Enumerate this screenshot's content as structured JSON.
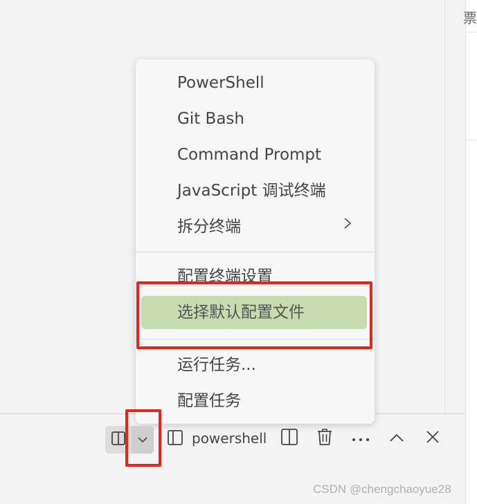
{
  "editor": {
    "right_edge_text": "票"
  },
  "menu": {
    "items": [
      {
        "label": "PowerShell"
      },
      {
        "label": "Git Bash"
      },
      {
        "label": "Command Prompt"
      },
      {
        "label": "JavaScript 调试终端"
      },
      {
        "label": "拆分终端",
        "submenu_icon": "chevron-right-icon"
      },
      {
        "label": "配置终端设置"
      },
      {
        "label": "选择默认配置文件",
        "highlighted": true
      },
      {
        "label": "运行任务..."
      },
      {
        "label": "配置任务"
      }
    ]
  },
  "toolbar": {
    "terminal_name": "powershell",
    "icons": [
      "split-layout-icon",
      "chevron-down-icon",
      "split-terminal-icon",
      "split-view-icon",
      "trash-icon",
      "more-icon",
      "chevron-up-icon",
      "close-icon"
    ]
  },
  "watermark": "CSDN @chengchaoyue28",
  "colors": {
    "highlight": "#c6dbae",
    "annotation_red": "#e8231c",
    "background": "#f3f3f3"
  }
}
